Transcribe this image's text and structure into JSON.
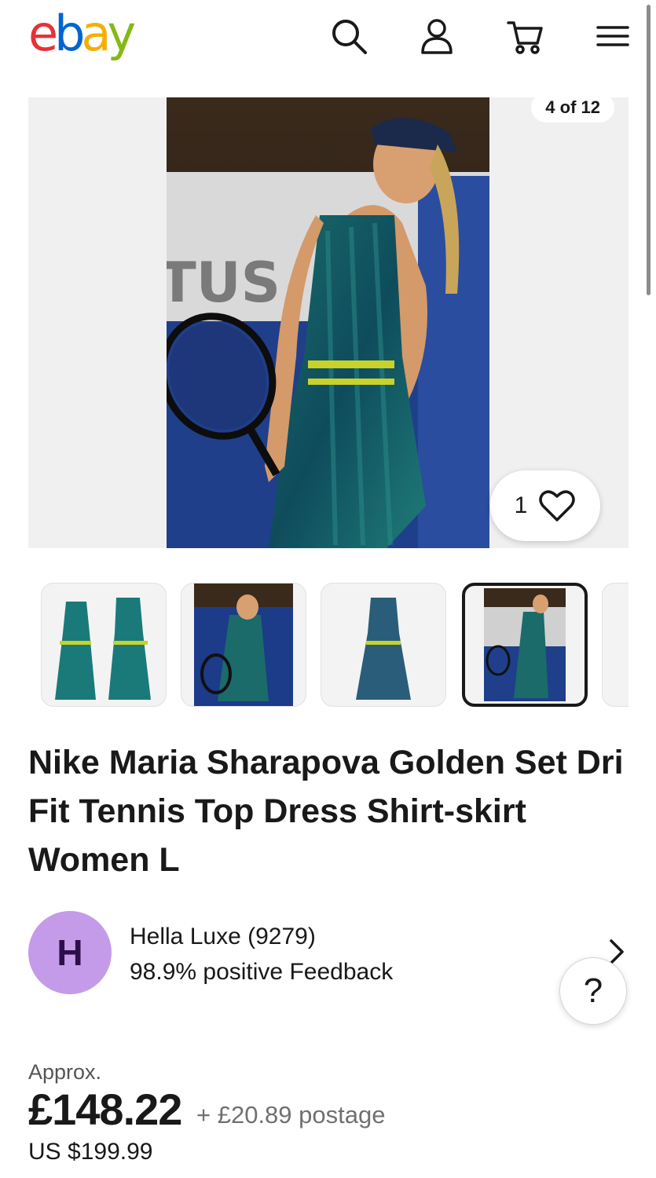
{
  "header": {
    "logo_letters": [
      "e",
      "b",
      "a",
      "y"
    ],
    "icons": [
      "search-icon",
      "account-icon",
      "cart-icon",
      "menu-icon"
    ]
  },
  "gallery": {
    "counter": "4 of 12",
    "watch_count": "1",
    "thumbnails": [
      "thumb-1",
      "thumb-2",
      "thumb-3",
      "thumb-4",
      "thumb-5"
    ],
    "selected_thumbnail": 4
  },
  "listing": {
    "title": "Nike Maria Sharapova Golden Set Dri Fit Tennis Top Dress Shirt-skirt Women L"
  },
  "seller": {
    "initial": "H",
    "name": "Hella Luxe (9279)",
    "feedback": "98.9% positive Feedback"
  },
  "help": {
    "label": "?"
  },
  "price": {
    "approx_label": "Approx.",
    "amount": "£148.22",
    "postage": "+ £20.89 postage",
    "usd": "US $199.99"
  },
  "colors": {
    "accent_red": "#e53238",
    "accent_blue": "#0064d2",
    "accent_yellow": "#f5af02",
    "accent_green": "#86b817",
    "avatar_bg": "#c49be8",
    "text": "#191919"
  }
}
